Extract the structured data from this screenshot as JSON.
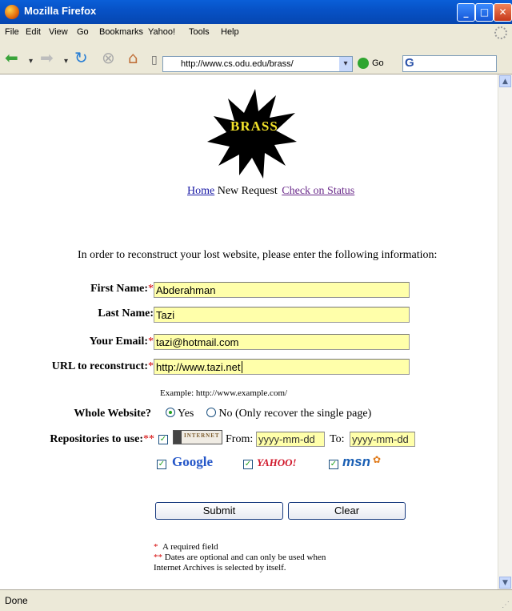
{
  "window": {
    "title": "Mozilla Firefox",
    "minimize": "_",
    "maximize": "□",
    "close": "✕"
  },
  "menu": [
    "File",
    "Edit",
    "View",
    "Go",
    "Bookmarks",
    "Yahoo!",
    "Tools",
    "Help"
  ],
  "toolbar": {
    "url": "http://www.cs.odu.edu/brass/",
    "go_label": "Go",
    "search_engine_letter": "G"
  },
  "page": {
    "logo_text": "BRASS",
    "nav": {
      "home": "Home",
      "current": "New Request",
      "status": "Check on Status"
    },
    "intro": "In order to reconstruct your lost website, please enter the following information:",
    "form": {
      "first_name": {
        "label": "First Name:",
        "required": "*",
        "value": "Abderahman"
      },
      "last_name": {
        "label": "Last Name:",
        "value": "Tazi"
      },
      "email": {
        "label": "Your Email:",
        "required": "*",
        "value": "tazi@hotmail.com"
      },
      "url": {
        "label": "URL to reconstruct:",
        "required": "*",
        "value": "http://www.tazi.net"
      },
      "url_example": "Example: http://www.example.com/",
      "whole_site": {
        "label": "Whole Website?",
        "option_yes": "Yes",
        "option_no": "No (Only recover the single page)",
        "selected": "Yes"
      },
      "repos": {
        "label": "Repositories to use:",
        "required": "**",
        "archive_logo": "INTERNET",
        "from_label": "From:",
        "to_label": "To:",
        "from_placeholder": "yyyy-mm-dd",
        "to_placeholder": "yyyy-mm-dd",
        "google": "Google",
        "yahoo": "YAHOO!",
        "msn": "msn"
      },
      "submit": "Submit",
      "clear": "Clear"
    },
    "notes": {
      "star": "*",
      "required_note": "A required field",
      "double_star": "**",
      "dates_note": "Dates are optional and can only be used when",
      "dates_note2": "Internet Archives is selected by itself."
    }
  },
  "status": "Done"
}
